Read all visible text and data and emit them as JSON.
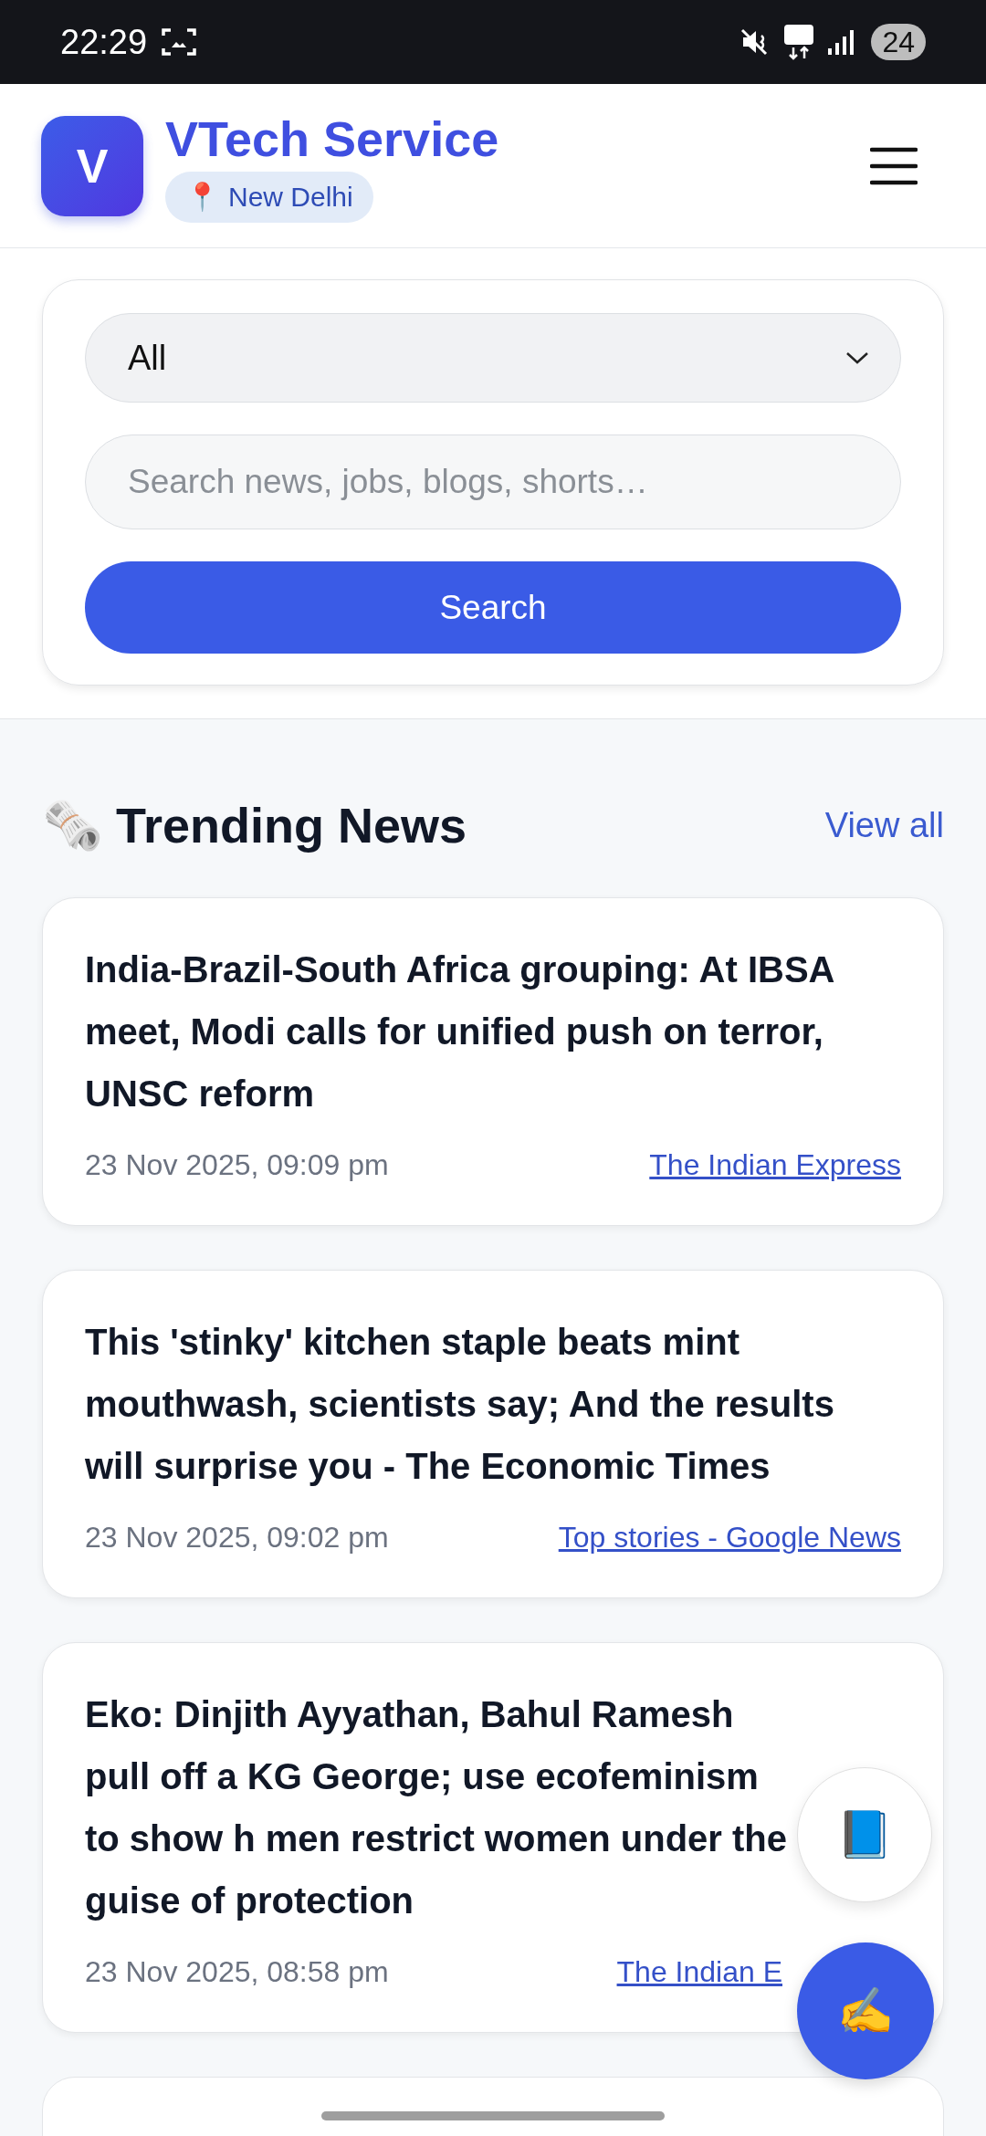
{
  "status_bar": {
    "time": "22:29",
    "battery": "24"
  },
  "header": {
    "logo_letter": "V",
    "title": "VTech Service",
    "location_icon": "📍",
    "location": "New Delhi"
  },
  "search": {
    "category": "All",
    "placeholder": "Search news, jobs, blogs, shorts…",
    "button": "Search"
  },
  "section": {
    "icon": "🗞️",
    "title": "Trending News",
    "link": "View all"
  },
  "news": [
    {
      "headline": "India-Brazil-South Africa grouping: At IBSA meet, Modi calls for unified push on terror, UNSC reform",
      "date": "23 Nov 2025, 09:09 pm",
      "source": "The Indian Express"
    },
    {
      "headline": "This 'stinky' kitchen staple beats mint mouthwash, scientists say; And the results will surprise you - The Economic Times",
      "date": "23 Nov 2025, 09:02 pm",
      "source": "Top stories - Google News"
    },
    {
      "headline": "Eko: Dinjith Ayyathan, Bahul Ramesh pull off a KG George; use ecofeminism to show h men restrict women under the guise of protection",
      "date": "23 Nov 2025, 08:58 pm",
      "source": "The Indian E"
    }
  ],
  "fabs": [
    {
      "icon": "📘",
      "kind": "secondary"
    },
    {
      "icon": "✍️",
      "kind": "primary"
    }
  ]
}
